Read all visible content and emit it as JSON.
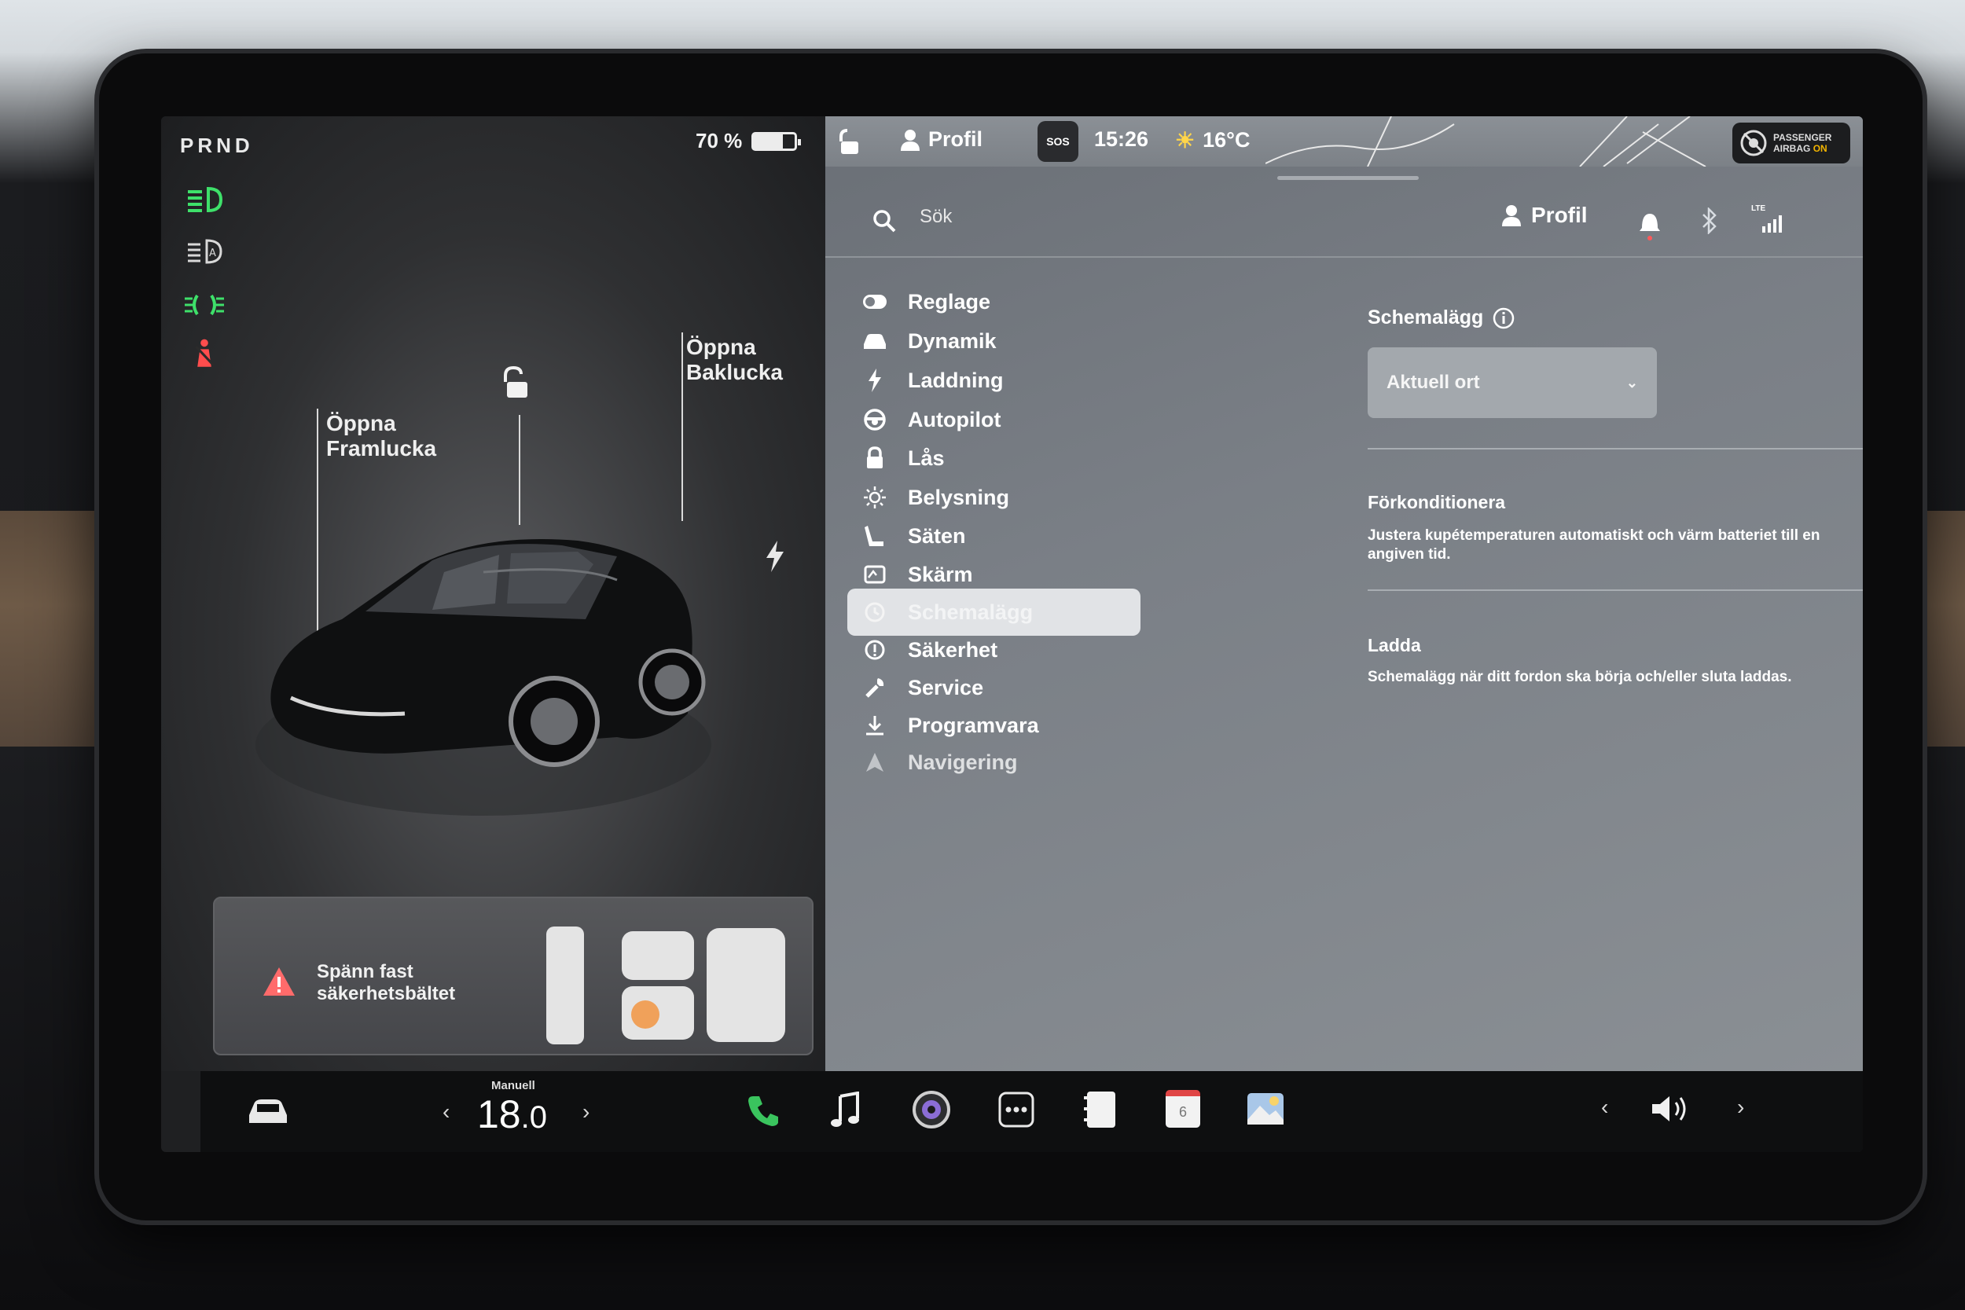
{
  "status": {
    "gear": "PRND",
    "battery_percent": "70 %",
    "battery_level": 0.7
  },
  "car": {
    "front_trunk_label": "Öppna\nFramlucka",
    "front_trunk_line1": "Öppna",
    "front_trunk_line2": "Framlucka",
    "rear_trunk_line1": "Öppna",
    "rear_trunk_line2": "Baklucka"
  },
  "seatbelt": {
    "warning_line1": "Spänn fast",
    "warning_line2": "säkerhetsbältet"
  },
  "topbar": {
    "profile": "Profil",
    "sos": "SOS",
    "time": "15:26",
    "temperature": "16°C",
    "airbag_line1": "PASSENGER",
    "airbag_line2": "AIRBAG",
    "airbag_state": "ON"
  },
  "search": {
    "placeholder": "Sök",
    "profile": "Profil",
    "network": "LTE"
  },
  "menu": {
    "items": [
      {
        "label": "Reglage",
        "icon": "toggle-icon"
      },
      {
        "label": "Dynamik",
        "icon": "car-icon"
      },
      {
        "label": "Laddning",
        "icon": "bolt-icon"
      },
      {
        "label": "Autopilot",
        "icon": "steering-wheel-icon"
      },
      {
        "label": "Lås",
        "icon": "lock-icon"
      },
      {
        "label": "Belysning",
        "icon": "sun-icon"
      },
      {
        "label": "Säten",
        "icon": "seat-icon"
      },
      {
        "label": "Skärm",
        "icon": "display-icon"
      },
      {
        "label": "Schemalägg",
        "icon": "clock-icon"
      },
      {
        "label": "Säkerhet",
        "icon": "info-icon"
      },
      {
        "label": "Service",
        "icon": "wrench-icon"
      },
      {
        "label": "Programvara",
        "icon": "download-icon"
      },
      {
        "label": "Navigering",
        "icon": "navigation-icon"
      }
    ],
    "active": "Schemalägg"
  },
  "schedule": {
    "title": "Schemalägg",
    "location_select": "Aktuell ort",
    "precondition_title": "Förkonditionera",
    "precondition_desc_line1": "Justera kupétemperaturen automatiskt och värm batteriet till en",
    "precondition_desc_line2": "angiven tid.",
    "charge_title": "Ladda",
    "charge_desc": "Schemalägg när ditt fordon ska börja och/eller sluta laddas."
  },
  "dock": {
    "climate_mode": "Manuell",
    "temp_whole": "18",
    "temp_decimal": ".0",
    "calendar_day": "6"
  },
  "colors": {
    "lamp_green": "#3ee06a",
    "warning_red": "#ff4d4d",
    "airbag_amber": "#f2b400",
    "phone_green": "#3ac45e"
  }
}
